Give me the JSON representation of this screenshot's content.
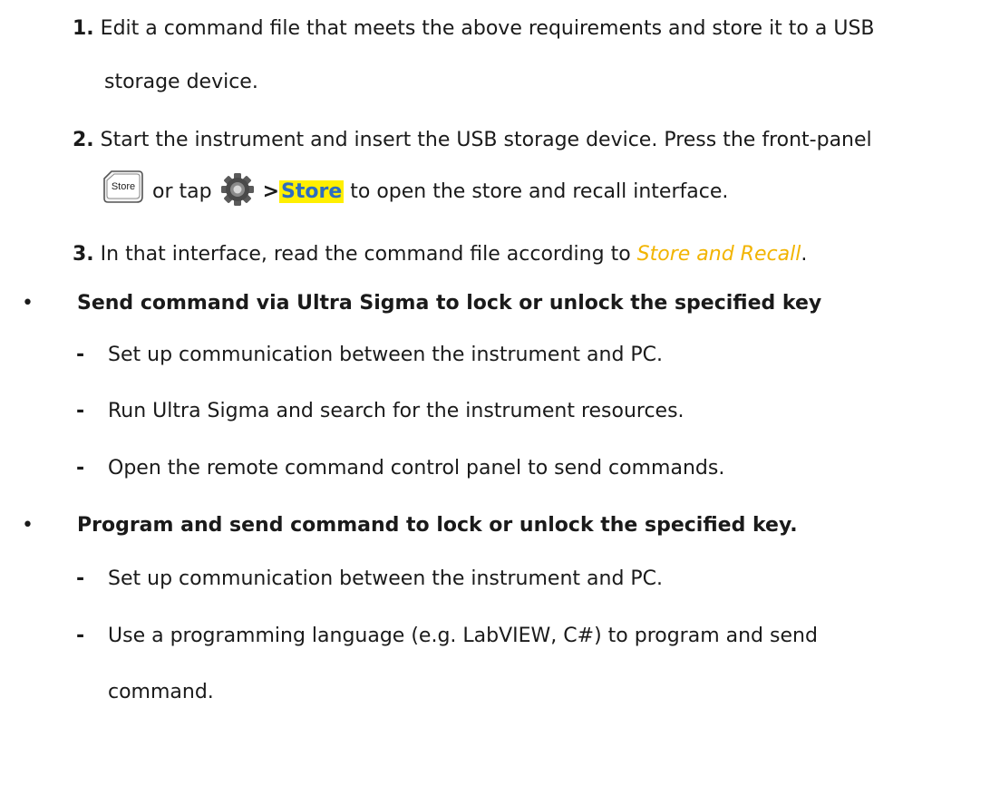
{
  "steps": [
    {
      "num": "1.",
      "text": "Edit a command file that meets the above requirements and store it to a USB",
      "cont": "storage device."
    },
    {
      "num": "2.",
      "text": "Start the instrument and insert the USB storage device. Press the front-panel"
    },
    {
      "key_label": "Store",
      "mid": "or tap",
      "sep": ">",
      "highlight": "Store",
      "after": "to open the store and recall interface."
    },
    {
      "num": "3.",
      "text_before": "In that interface, read the command file according to",
      "link": "Store and Recall",
      "text_after": "."
    }
  ],
  "sections": [
    {
      "bullet": "•",
      "title": "Send command via Ultra Sigma to lock or unlock the specified key",
      "items": [
        "Set up communication between the instrument and PC.",
        "Run Ultra Sigma and search for the instrument resources.",
        "Open the remote command control panel to send commands."
      ]
    },
    {
      "bullet": "•",
      "title": "Program and send command to lock or unlock the specified key.",
      "items": [
        "Set up communication between the instrument and PC.",
        "Use a programming language (e.g. LabVIEW, C#) to program and send",
        "command."
      ]
    }
  ],
  "dash": "-",
  "colors": {
    "link": "#f2b400",
    "highlight_bg": "#ffef00",
    "highlight_text": "#2d6cc0"
  },
  "icons": {
    "store_key": "store-key-icon",
    "gear": "gear-icon"
  }
}
